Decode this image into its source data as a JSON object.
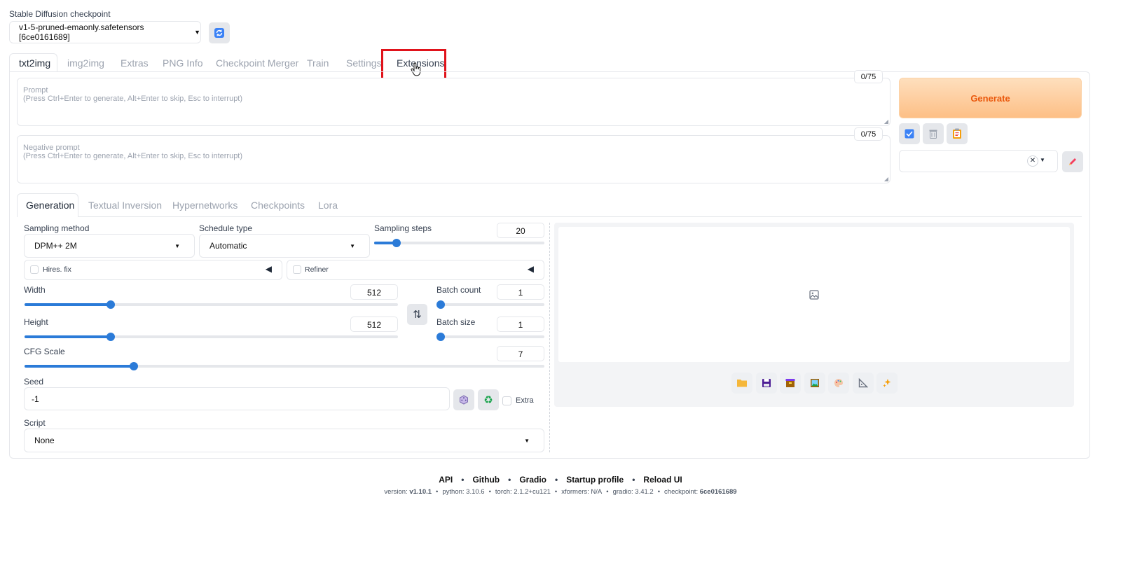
{
  "checkpoint": {
    "label": "Stable Diffusion checkpoint",
    "value": "v1-5-pruned-emaonly.safetensors [6ce0161689]"
  },
  "main_tabs": [
    {
      "label": "txt2img",
      "active": true
    },
    {
      "label": "img2img"
    },
    {
      "label": "Extras"
    },
    {
      "label": "PNG Info"
    },
    {
      "label": "Checkpoint Merger"
    },
    {
      "label": "Train"
    },
    {
      "label": "Settings"
    },
    {
      "label": "Extensions",
      "highlighted": true
    }
  ],
  "prompt": {
    "placeholder_line1": "Prompt",
    "placeholder_line2": "(Press Ctrl+Enter to generate, Alt+Enter to skip, Esc to interrupt)",
    "token_count": "0/75"
  },
  "negative_prompt": {
    "placeholder_line1": "Negative prompt",
    "placeholder_line2": "(Press Ctrl+Enter to generate, Alt+Enter to skip, Esc to interrupt)",
    "token_count": "0/75"
  },
  "generate": {
    "label": "Generate"
  },
  "sub_tabs": [
    {
      "label": "Generation",
      "active": true
    },
    {
      "label": "Textual Inversion"
    },
    {
      "label": "Hypernetworks"
    },
    {
      "label": "Checkpoints"
    },
    {
      "label": "Lora"
    }
  ],
  "sampling_method": {
    "label": "Sampling method",
    "value": "DPM++ 2M"
  },
  "schedule_type": {
    "label": "Schedule type",
    "value": "Automatic"
  },
  "sampling_steps": {
    "label": "Sampling steps",
    "value": "20",
    "fraction": 0.13
  },
  "hires_fix": {
    "label": "Hires. fix"
  },
  "refiner": {
    "label": "Refiner"
  },
  "width": {
    "label": "Width",
    "value": "512",
    "fraction": 0.23
  },
  "height": {
    "label": "Height",
    "value": "512",
    "fraction": 0.23
  },
  "batch_count": {
    "label": "Batch count",
    "value": "1",
    "fraction": 0.0
  },
  "batch_size": {
    "label": "Batch size",
    "value": "1",
    "fraction": 0.0
  },
  "cfg_scale": {
    "label": "CFG Scale",
    "value": "7",
    "fraction": 0.21
  },
  "seed": {
    "label": "Seed",
    "value": "-1",
    "extra_label": "Extra"
  },
  "script": {
    "label": "Script",
    "value": "None"
  },
  "footer": {
    "links": [
      "API",
      "Github",
      "Gradio",
      "Startup profile",
      "Reload UI"
    ],
    "version_prefix": "version:",
    "version": "v1.10.1",
    "python": "python: 3.10.6",
    "torch": "torch: 2.1.2+cu121",
    "xformers": "xformers: N/A",
    "gradio": "gradio: 3.41.2",
    "checkpoint_prefix": "checkpoint:",
    "checkpoint": "6ce0161689"
  },
  "colors": {
    "accent": "#2b7bd8",
    "generate_bg": "#fdc894",
    "generate_text": "#ea580c",
    "highlight_box": "#e0131b"
  }
}
